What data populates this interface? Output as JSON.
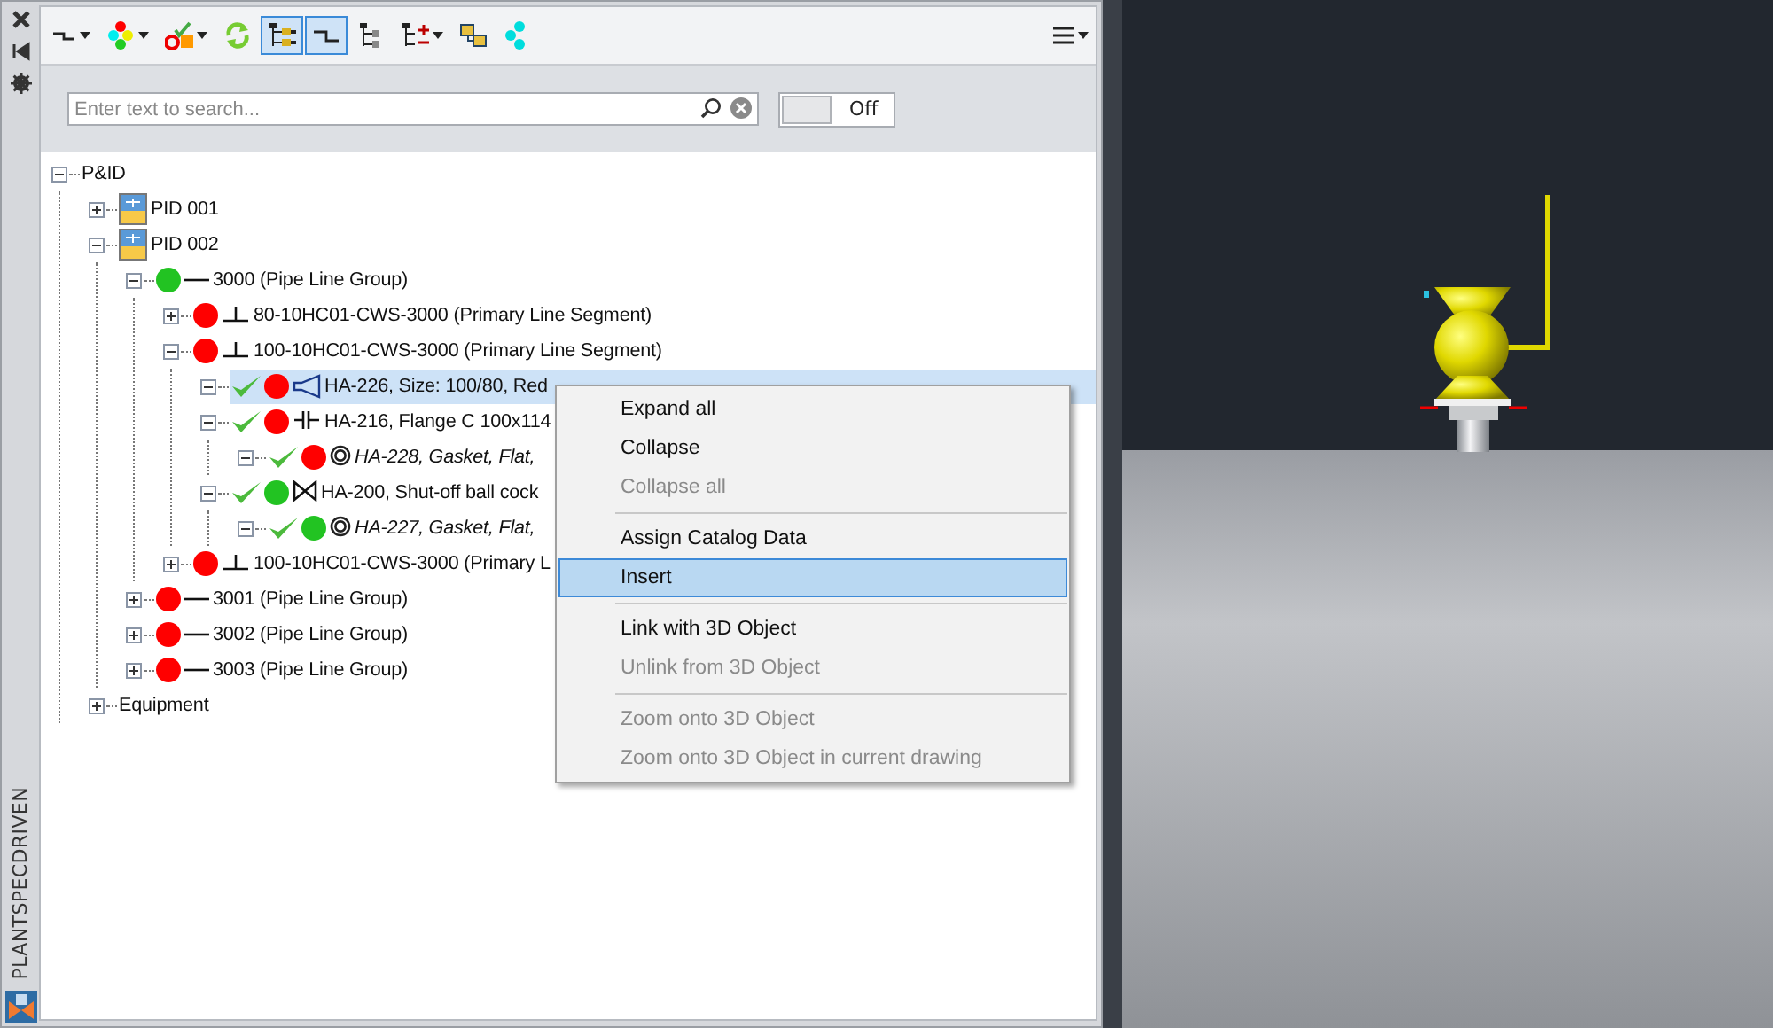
{
  "palette": {
    "title": "PLANTSPECDRIVEN"
  },
  "toolbar": [
    {
      "kind": "line",
      "pressed": false,
      "dropdown": true
    },
    {
      "kind": "dots",
      "pressed": false,
      "dropdown": true
    },
    {
      "kind": "checkdots",
      "pressed": false,
      "dropdown": true
    },
    {
      "kind": "refresh",
      "pressed": false,
      "dropdown": false
    },
    {
      "kind": "tree",
      "pressed": true,
      "dropdown": false
    },
    {
      "kind": "step",
      "pressed": true,
      "dropdown": false
    },
    {
      "kind": "treelist",
      "pressed": false,
      "dropdown": false
    },
    {
      "kind": "treeplus",
      "pressed": false,
      "dropdown": true
    },
    {
      "kind": "linked",
      "pressed": false,
      "dropdown": false
    },
    {
      "kind": "cluster",
      "pressed": false,
      "dropdown": false
    }
  ],
  "search": {
    "placeholder": "Enter text to search...",
    "toggle": {
      "label": "Off",
      "on": false
    }
  },
  "tree": [
    {
      "label": "P&ID",
      "expanded": true,
      "selected": false,
      "children": [
        {
          "label": "PID 001",
          "kind": "drawing",
          "expanded": false,
          "selected": false
        },
        {
          "label": "PID 002",
          "kind": "drawing",
          "expanded": true,
          "selected": false,
          "children": [
            {
              "label": "3000 (Pipe Line Group)",
              "kind": "group",
              "color": "#22c322",
              "expanded": true,
              "selected": false,
              "children": [
                {
                  "label": "80-10HC01-CWS-3000 (Primary Line Segment)",
                  "kind": "segment",
                  "color": "#ff0000",
                  "expanded": false,
                  "selected": false
                },
                {
                  "label": "100-10HC01-CWS-3000 (Primary Line Segment)",
                  "kind": "segment",
                  "color": "#ff0000",
                  "expanded": true,
                  "selected": false,
                  "children": [
                    {
                      "label": "HA-226, Size: 100/80, Red",
                      "kind": "reducer",
                      "color": "#ff0000",
                      "checked": true,
                      "expanded": true,
                      "selected": true
                    },
                    {
                      "label": "HA-216, Flange C 100x114",
                      "kind": "flange",
                      "color": "#ff0000",
                      "checked": true,
                      "expanded": true,
                      "selected": false,
                      "children": [
                        {
                          "label": "HA-228, Gasket, Flat,",
                          "kind": "gasket",
                          "color": "#ff0000",
                          "checked": true,
                          "expanded": true,
                          "selected": false
                        }
                      ]
                    },
                    {
                      "label": "HA-200, Shut-off ball cock",
                      "kind": "valve",
                      "color": "#22c322",
                      "checked": true,
                      "expanded": true,
                      "selected": false,
                      "children": [
                        {
                          "label": "HA-227, Gasket, Flat,",
                          "kind": "gasket",
                          "color": "#22c322",
                          "checked": true,
                          "expanded": true,
                          "selected": false
                        }
                      ]
                    }
                  ]
                },
                {
                  "label": "100-10HC01-CWS-3000 (Primary L",
                  "kind": "segment",
                  "color": "#ff0000",
                  "expanded": false,
                  "selected": false
                }
              ]
            },
            {
              "label": "3001 (Pipe Line Group)",
              "kind": "group",
              "color": "#ff0000",
              "expanded": false,
              "selected": false
            },
            {
              "label": "3002 (Pipe Line Group)",
              "kind": "group",
              "color": "#ff0000",
              "expanded": false,
              "selected": false
            },
            {
              "label": "3003 (Pipe Line Group)",
              "kind": "group",
              "color": "#ff0000",
              "expanded": false,
              "selected": false
            }
          ]
        },
        {
          "label": "Equipment",
          "expanded": false,
          "selected": false
        }
      ]
    }
  ],
  "context_menu": [
    {
      "label": "Expand all",
      "disabled": false,
      "selected": false
    },
    {
      "label": "Collapse",
      "disabled": false,
      "selected": false
    },
    {
      "label": "Collapse all",
      "disabled": true,
      "selected": false
    },
    {
      "kind": "separator"
    },
    {
      "label": "Assign Catalog Data",
      "disabled": false,
      "selected": false
    },
    {
      "label": "Insert",
      "disabled": false,
      "selected": true
    },
    {
      "kind": "separator"
    },
    {
      "label": "Link with 3D Object",
      "disabled": false,
      "selected": false
    },
    {
      "label": "Unlink from 3D Object",
      "disabled": true,
      "selected": false
    },
    {
      "kind": "separator"
    },
    {
      "label": "Zoom onto 3D Object",
      "disabled": true,
      "selected": false
    },
    {
      "label": "Zoom onto 3D Object in current drawing",
      "disabled": true,
      "selected": false
    }
  ]
}
